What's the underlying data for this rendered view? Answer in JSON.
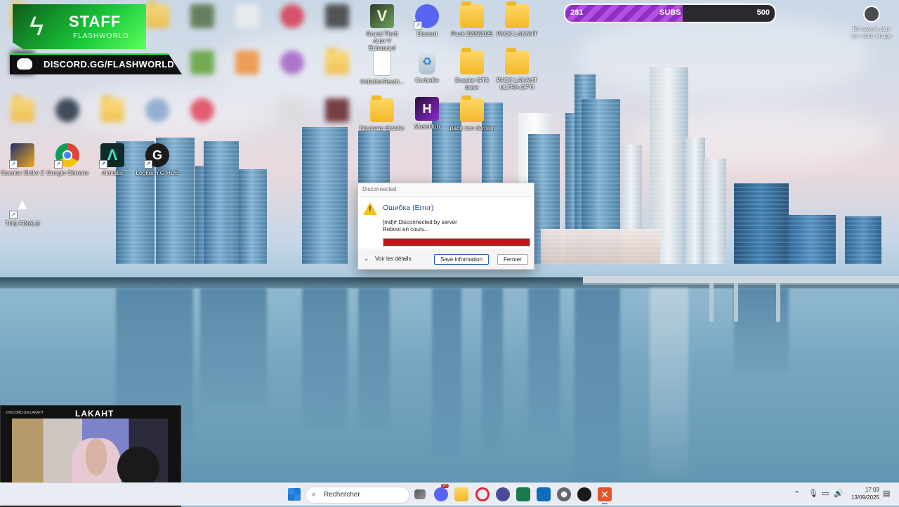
{
  "overlay": {
    "staff_title": "STAFF",
    "staff_subtitle": "FLASHWORLD",
    "discord_invite": "DISCORD.GG/FLASHWORLD",
    "subs_current": "281",
    "subs_label": "SUBS",
    "subs_goal": "500",
    "subs_progress_fraction": 0.56,
    "learn_more": "En savoir plus sur cette image"
  },
  "desktop": {
    "icons": [
      {
        "id": "gta",
        "label": "Grand Theft Auto V Enhanced",
        "icon": "gta-icon"
      },
      {
        "id": "discord",
        "label": "Discord",
        "icon": "discord-icon"
      },
      {
        "id": "pack",
        "label": "Pack 22052025",
        "icon": "folder-icon"
      },
      {
        "id": "pack-lakaht",
        "label": "PACK LAKAHT",
        "icon": "folder-icon"
      },
      {
        "id": "noeditor",
        "label": "NoEditorRestri...",
        "icon": "file-icon"
      },
      {
        "id": "corbeille",
        "label": "Corbeille",
        "icon": "recycle-bin-icon"
      },
      {
        "id": "dossier-gta",
        "label": "Dossier GTA base",
        "icon": "folder-icon"
      },
      {
        "id": "pack-lakaht-ultra",
        "label": "PACK LAKAHT ULTRA OPTI",
        "icon": "folder-icon"
      },
      {
        "id": "nouveau",
        "label": "Nouveau dossier",
        "icon": "folder-icon"
      },
      {
        "id": "musehub",
        "label": "MuseHub",
        "icon": "musehub-icon"
      },
      {
        "id": "pack-son",
        "label": "pack son dernier",
        "icon": "folder-icon"
      },
      {
        "id": "cs2",
        "label": "Counter Strike 2",
        "icon": "cs2-icon"
      },
      {
        "id": "chrome",
        "label": "Google Chrome",
        "icon": "chrome-icon"
      },
      {
        "id": "aimlabs",
        "label": "Aimlabs",
        "icon": "aimlabs-icon"
      },
      {
        "id": "ghub",
        "label": "Logitech G HUB",
        "icon": "logitech-icon"
      },
      {
        "id": "finals",
        "label": "THE FINALS",
        "icon": "the-finals-icon"
      }
    ]
  },
  "dialog": {
    "title": "Disconnected",
    "heading": "Ошибка (Error)",
    "message_line1": "[md]# Disconnected by server",
    "message_line2": "Reboot en cours...",
    "details_label": "Voir les détails",
    "save_label": "Save information",
    "close_label": "Fermer",
    "progress_fraction": 1.0,
    "progress_color": "#b41b1b"
  },
  "webcam": {
    "streamer_name": "LAKAHT",
    "top_caption": "DISCORD.GG/LAKAHT"
  },
  "taskbar": {
    "search_placeholder": "Rechercher",
    "badge": "9+",
    "time": "17:03",
    "date": "13/09/2025"
  }
}
